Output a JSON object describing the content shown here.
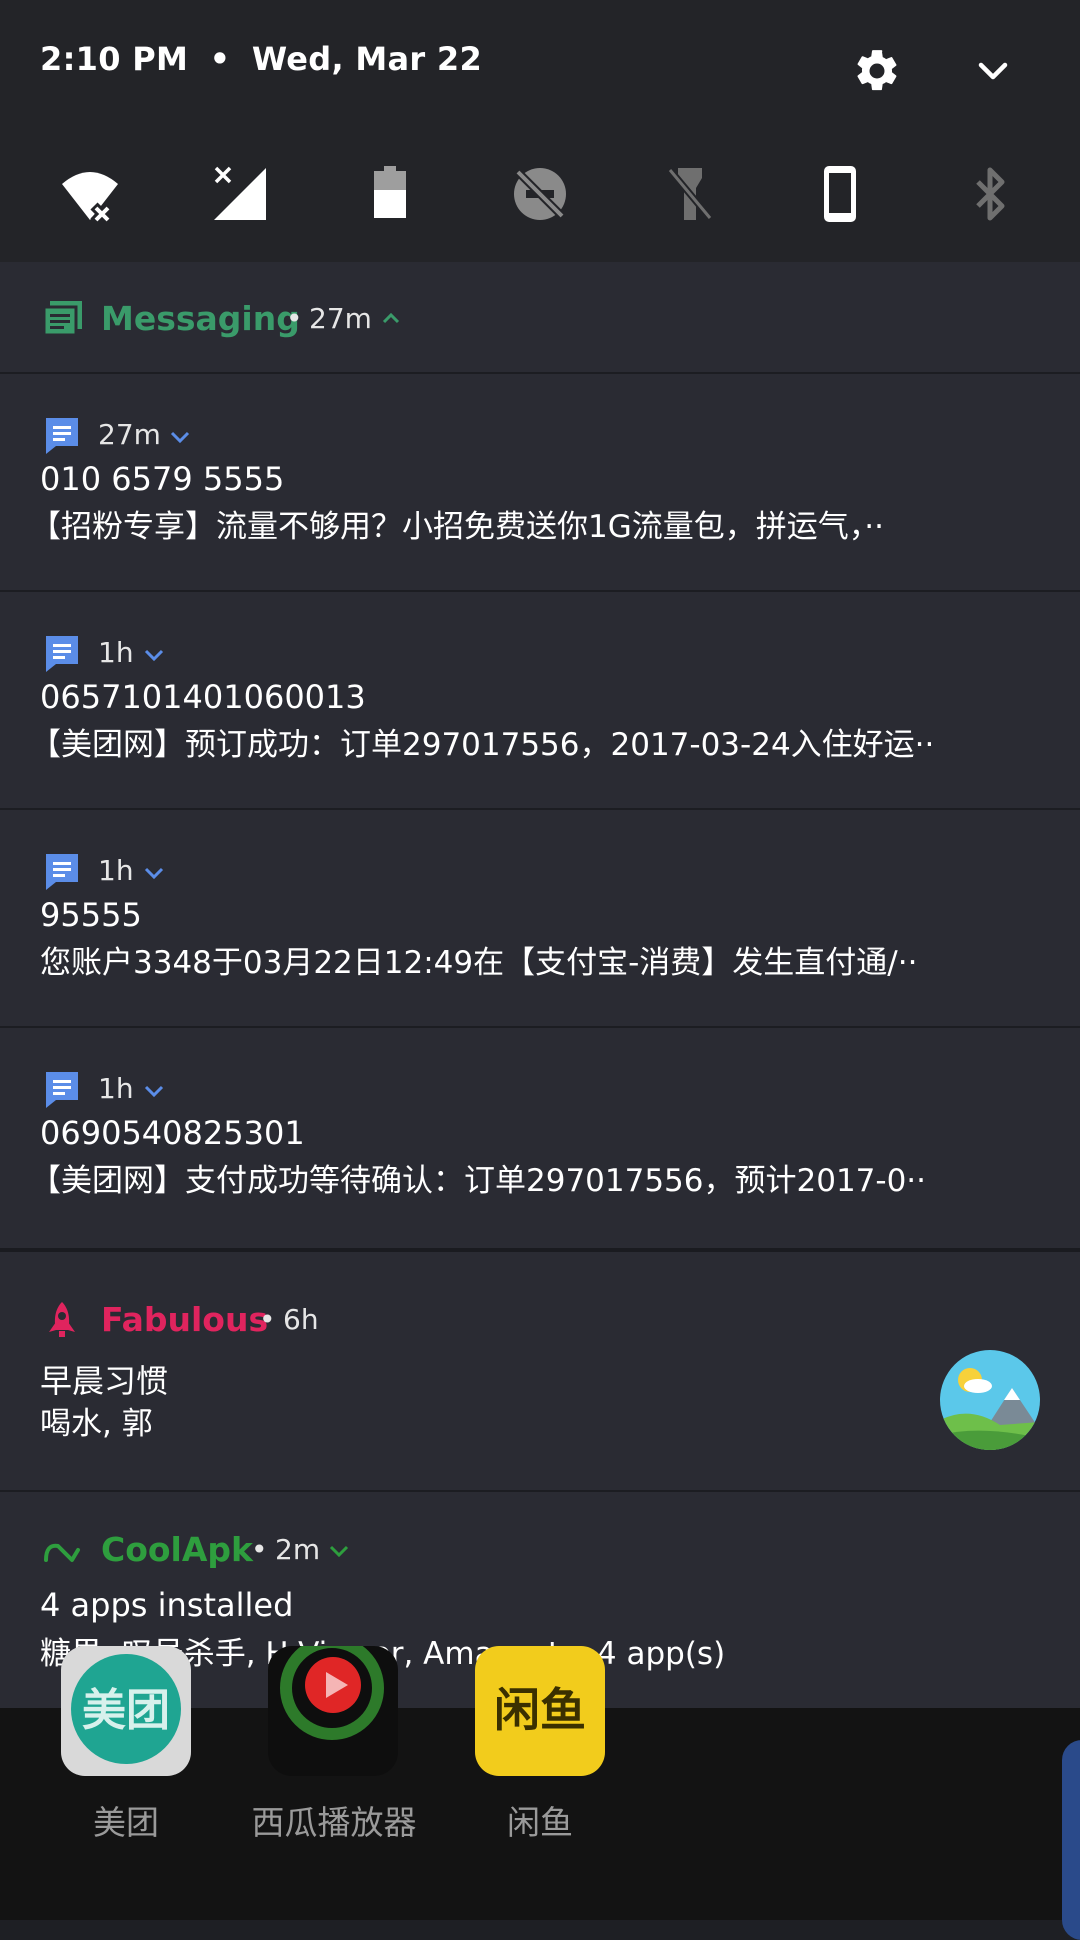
{
  "status": {
    "time": "2:10 PM",
    "separator": "•",
    "date": "Wed, Mar 22"
  },
  "quick_settings": {
    "settings_icon": "gear-icon",
    "collapse_icon": "chevron-down-icon",
    "tiles": [
      {
        "name": "wifi-off-icon"
      },
      {
        "name": "cellular-no-signal-icon"
      },
      {
        "name": "battery-icon"
      },
      {
        "name": "do-not-disturb-off-icon"
      },
      {
        "name": "flashlight-off-icon"
      },
      {
        "name": "phone-rotation-icon"
      },
      {
        "name": "bluetooth-off-icon"
      }
    ]
  },
  "notifications": {
    "messaging": {
      "app": "Messaging",
      "dot": "•",
      "time": "27m",
      "accent": "#3a9b6a",
      "messages": [
        {
          "time": "27m",
          "sender": "010 6579 5555",
          "text": "【招粉专享】流量不够用？小招免费送你1G流量包，拼运气，··"
        },
        {
          "time": "1h",
          "sender": "0657101401060013",
          "text": "【美团网】预订成功：订单297017556，2017-03-24入住好运··"
        },
        {
          "time": "1h",
          "sender": "95555",
          "text": "您账户3348于03月22日12:49在【支付宝-消费】发生直付通/··"
        },
        {
          "time": "1h",
          "sender": "0690540825301",
          "text": "【美团网】支付成功等待确认：订单297017556，预计2017-0··"
        }
      ]
    },
    "fabulous": {
      "app": "Fabulous",
      "dot": "•",
      "time": "6h",
      "accent": "#e0245e",
      "title": "早晨习惯",
      "text": "喝水, 郭"
    },
    "coolapk": {
      "app": "CoolApk",
      "dot": "•",
      "time": "2m",
      "accent": "#2e9e3e",
      "title": "4 apps installed",
      "text": "糖果, 叹号杀手, H-Viewer, Amazeetc. 4 app(s)"
    }
  },
  "home_apps": [
    {
      "label": "美团",
      "icon_text": "美团",
      "color": "#1fa592"
    },
    {
      "label": "西瓜播放器",
      "icon_text": "",
      "color": "#e02626"
    },
    {
      "label": "闲鱼",
      "icon_text": "闲鱼",
      "color": "#f2cc1c"
    }
  ]
}
